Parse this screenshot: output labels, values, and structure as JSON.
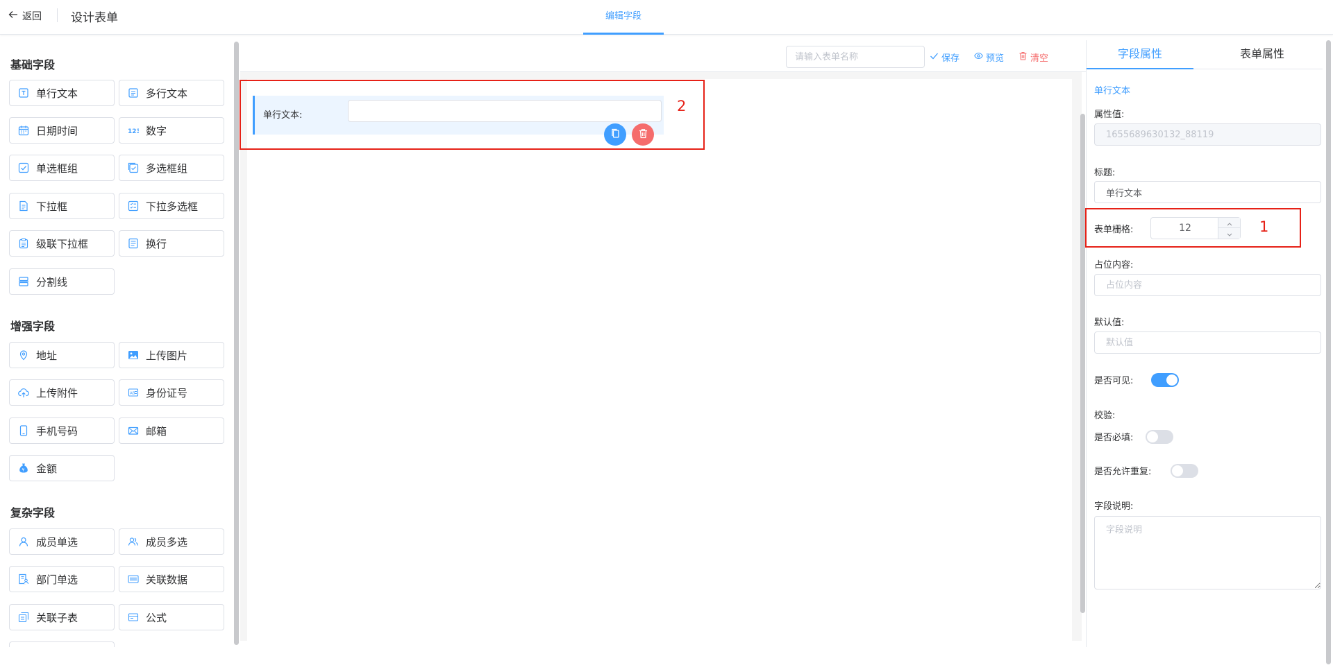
{
  "header": {
    "back_label": "返回",
    "title": "设计表单",
    "tab_label": "编辑字段"
  },
  "sidebar": {
    "groups": [
      {
        "title": "基础字段",
        "items": [
          {
            "label": "单行文本",
            "icon": "single-line-text-icon"
          },
          {
            "label": "多行文本",
            "icon": "multi-line-text-icon"
          },
          {
            "label": "日期时间",
            "icon": "calendar-icon"
          },
          {
            "label": "数字",
            "icon": "number-icon"
          },
          {
            "label": "单选框组",
            "icon": "radio-group-icon"
          },
          {
            "label": "多选框组",
            "icon": "checkbox-group-icon"
          },
          {
            "label": "下拉框",
            "icon": "select-icon"
          },
          {
            "label": "下拉多选框",
            "icon": "multi-select-icon"
          },
          {
            "label": "级联下拉框",
            "icon": "cascader-icon"
          },
          {
            "label": "换行",
            "icon": "line-break-icon"
          },
          {
            "label": "分割线",
            "icon": "divider-icon"
          }
        ]
      },
      {
        "title": "增强字段",
        "items": [
          {
            "label": "地址",
            "icon": "location-icon"
          },
          {
            "label": "上传图片",
            "icon": "image-icon"
          },
          {
            "label": "上传附件",
            "icon": "cloud-upload-icon"
          },
          {
            "label": "身份证号",
            "icon": "id-card-icon"
          },
          {
            "label": "手机号码",
            "icon": "phone-icon"
          },
          {
            "label": "邮箱",
            "icon": "mail-icon"
          },
          {
            "label": "金额",
            "icon": "money-bag-icon"
          }
        ]
      },
      {
        "title": "复杂字段",
        "items": [
          {
            "label": "成员单选",
            "icon": "user-icon"
          },
          {
            "label": "成员多选",
            "icon": "users-icon"
          },
          {
            "label": "部门单选",
            "icon": "department-icon"
          },
          {
            "label": "关联数据",
            "icon": "barcode-icon"
          },
          {
            "label": "关联子表",
            "icon": "sub-table-icon"
          },
          {
            "label": "公式",
            "icon": "formula-icon"
          }
        ]
      }
    ]
  },
  "toolbar": {
    "form_name_placeholder": "请输入表单名称",
    "save_label": "保存",
    "preview_label": "预览",
    "clear_label": "清空"
  },
  "canvas": {
    "field_label": "单行文本:"
  },
  "annotations": {
    "box1": "1",
    "box2": "2"
  },
  "properties": {
    "tabs": [
      "字段属性",
      "表单属性"
    ],
    "field_type": "单行文本",
    "attr_value_label": "属性值:",
    "attr_value": "1655689630132_88119",
    "title_label": "标题:",
    "title_value": "单行文本",
    "grid_label": "表单栅格:",
    "grid_value": "12",
    "placeholder_label": "占位内容:",
    "placeholder_hint": "占位内容",
    "default_label": "默认值:",
    "default_hint": "默认值",
    "visible_label": "是否可见:",
    "visible": true,
    "validation_label": "校验:",
    "required_label": "是否必填:",
    "required": false,
    "allow_dup_label": "是否允许重复:",
    "allow_dup": false,
    "description_label": "字段说明:",
    "description_hint": "字段说明"
  },
  "colors": {
    "primary": "#409eff",
    "danger": "#f56c6c",
    "annotation": "#e62117"
  }
}
